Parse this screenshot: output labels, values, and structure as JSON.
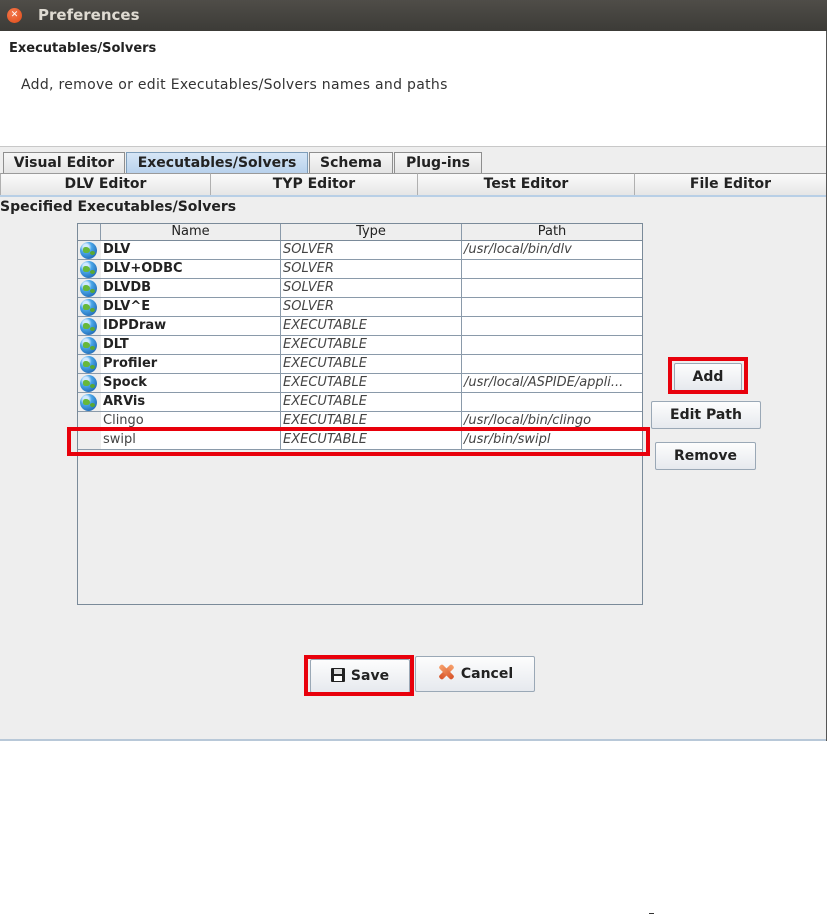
{
  "window": {
    "title": "Preferences"
  },
  "header": {
    "title": "Executables/Solvers",
    "description": "Add, remove or edit Executables/Solvers names and paths"
  },
  "tabs_primary": [
    "Visual Editor",
    "Executables/Solvers",
    "Schema",
    "Plug-ins"
  ],
  "tabs_primary_selected": "Executables/Solvers",
  "tabs_secondary": [
    "DLV Editor",
    "TYP Editor",
    "Test Editor",
    "File Editor"
  ],
  "section_label": "Specified Executables/Solvers",
  "table": {
    "columns": [
      "Name",
      "Type",
      "Path"
    ],
    "rows": [
      {
        "icon": "globe-icon",
        "name": "DLV",
        "type": "SOLVER",
        "path": "/usr/local/bin/dlv"
      },
      {
        "icon": "globe-icon",
        "name": "DLV+ODBC",
        "type": "SOLVER",
        "path": ""
      },
      {
        "icon": "globe-icon",
        "name": "DLVDB",
        "type": "SOLVER",
        "path": ""
      },
      {
        "icon": "globe-icon",
        "name": "DLV^E",
        "type": "SOLVER",
        "path": ""
      },
      {
        "icon": "globe-icon",
        "name": "IDPDraw",
        "type": "EXECUTABLE",
        "path": ""
      },
      {
        "icon": "globe-icon",
        "name": "DLT",
        "type": "EXECUTABLE",
        "path": ""
      },
      {
        "icon": "globe-icon",
        "name": "Profiler",
        "type": "EXECUTABLE",
        "path": ""
      },
      {
        "icon": "globe-icon",
        "name": "Spock",
        "type": "EXECUTABLE",
        "path": "/usr/local/ASPIDE/appli..."
      },
      {
        "icon": "globe-icon",
        "name": "ARVis",
        "type": "EXECUTABLE",
        "path": ""
      },
      {
        "icon": "",
        "name": "Clingo",
        "type": "EXECUTABLE",
        "path": "/usr/local/bin/clingo"
      },
      {
        "icon": "",
        "name": "swipl",
        "type": "EXECUTABLE",
        "path": "/usr/bin/swipl"
      }
    ]
  },
  "buttons": {
    "add": "Add",
    "edit_path": "Edit Path",
    "remove": "Remove",
    "save": "Save",
    "cancel": "Cancel"
  },
  "colors": {
    "highlight": "#e8000b",
    "selected_tab": "#b8d1ec"
  }
}
